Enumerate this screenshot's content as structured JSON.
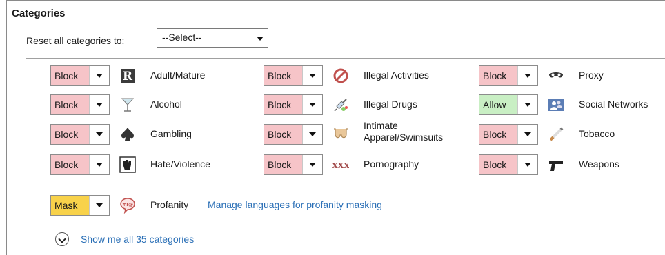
{
  "header": {
    "title": "Categories"
  },
  "reset": {
    "label": "Reset all categories to:",
    "value": "--Select--"
  },
  "categories": [
    {
      "name": "Adult/Mature",
      "action": "Block",
      "icon": "adult-rating-icon"
    },
    {
      "name": "Alcohol",
      "action": "Block",
      "icon": "cocktail-glass-icon"
    },
    {
      "name": "Gambling",
      "action": "Block",
      "icon": "spade-icon"
    },
    {
      "name": "Hate/Violence",
      "action": "Block",
      "icon": "raised-fist-icon"
    },
    {
      "name": "Illegal Activities",
      "action": "Block",
      "icon": "prohibited-icon"
    },
    {
      "name": "Illegal Drugs",
      "action": "Block",
      "icon": "syringe-icon"
    },
    {
      "name_line1": "Intimate",
      "name_line2": "Apparel/Swimsuits",
      "action": "Block",
      "icon": "bikini-icon"
    },
    {
      "name": "Pornography",
      "action": "Block",
      "icon": "xxx-icon"
    },
    {
      "name": "Proxy",
      "action": "Block",
      "icon": "mask-icon"
    },
    {
      "name": "Social Networks",
      "action": "Allow",
      "icon": "people-icon"
    },
    {
      "name": "Tobacco",
      "action": "Block",
      "icon": "cigarette-icon"
    },
    {
      "name": "Weapons",
      "action": "Block",
      "icon": "pistol-icon"
    }
  ],
  "profanity": {
    "action": "Mask",
    "name": "Profanity",
    "link": "Manage languages for profanity masking",
    "icon": "speech-bubble-icon"
  },
  "show_all": {
    "label": "Show me all 35 categories"
  },
  "colors": {
    "block": "#f6c4c8",
    "allow": "#c9efc4",
    "mask": "#f8d24a",
    "link": "#2a6fb6"
  }
}
